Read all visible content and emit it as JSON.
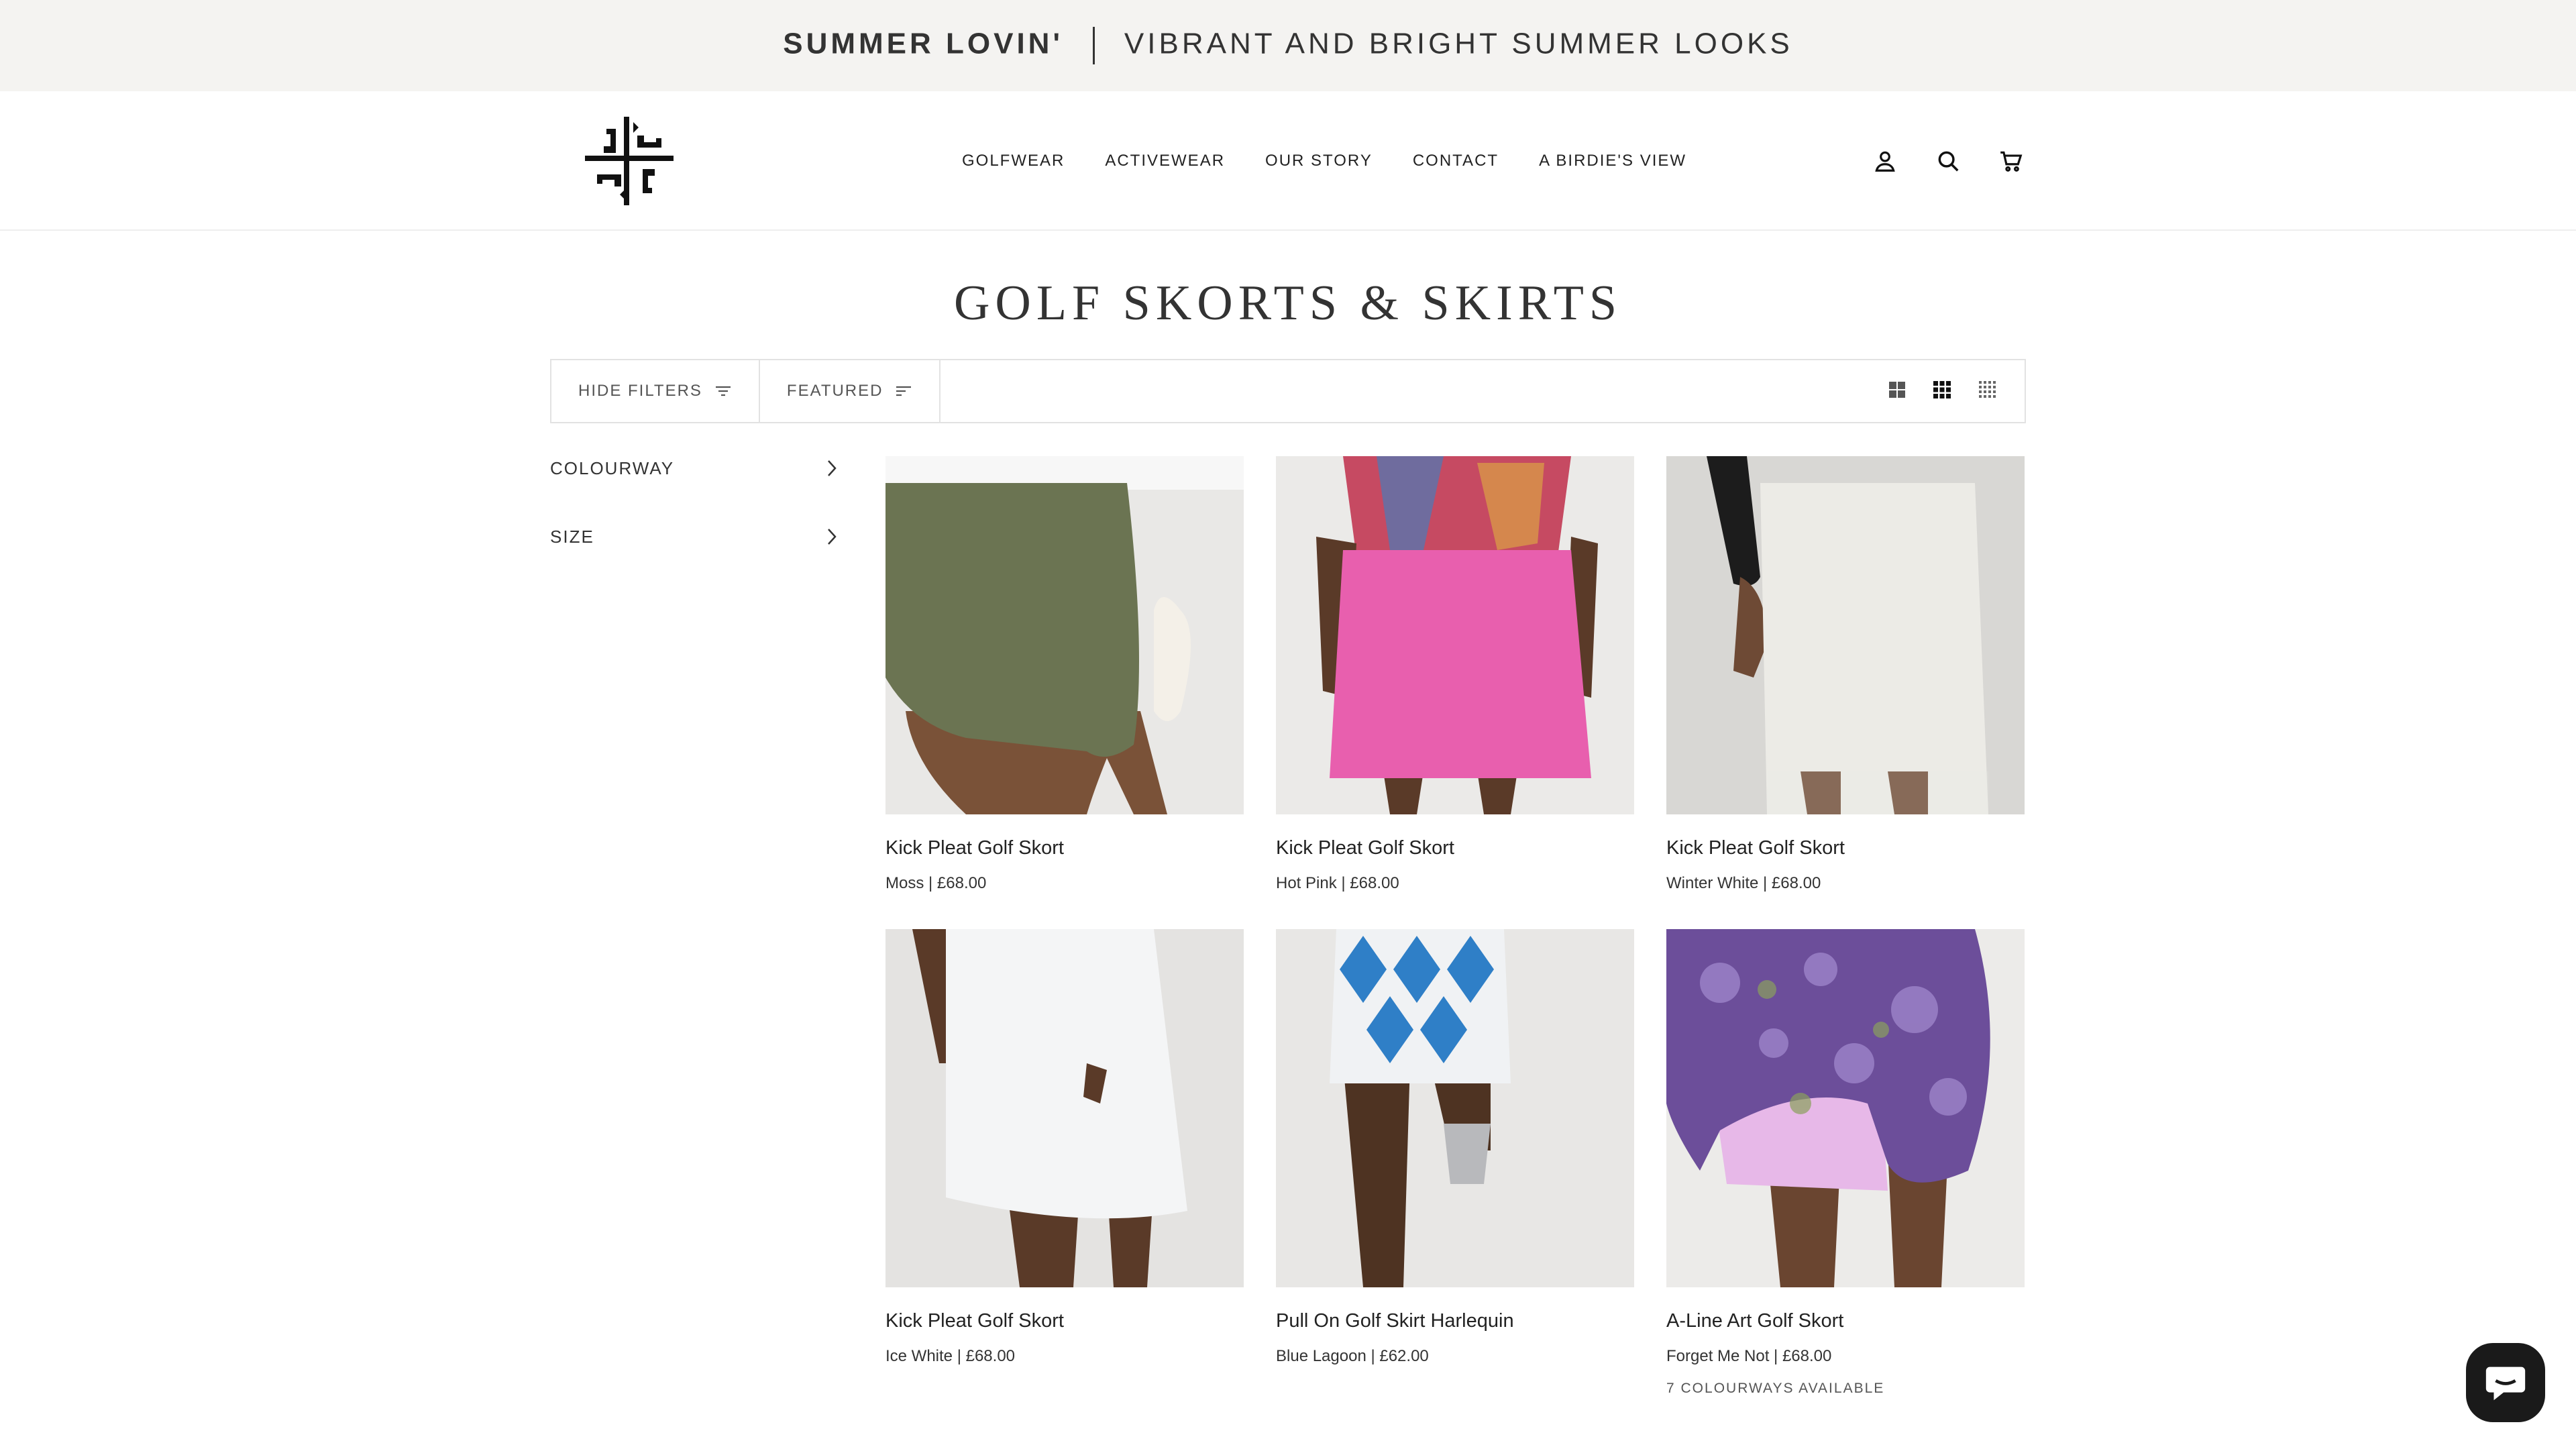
{
  "announcement": {
    "bold": "SUMMER LOVIN'",
    "text": "VIBRANT AND BRIGHT SUMMER LOOKS"
  },
  "header": {
    "logo": "brand-logo",
    "nav": [
      "GOLFWEAR",
      "ACTIVEWEAR",
      "OUR STORY",
      "CONTACT",
      "A BIRDIE'S VIEW"
    ],
    "icons": [
      "account-icon",
      "search-icon",
      "cart-icon"
    ]
  },
  "page": {
    "title": "GOLF SKORTS & SKIRTS"
  },
  "toolbar": {
    "hide_filters": "HIDE FILTERS",
    "sort": "FEATURED",
    "view_icons": [
      "grid-large-icon",
      "grid-medium-icon",
      "grid-small-icon"
    ]
  },
  "filters": [
    {
      "label": "COLOURWAY"
    },
    {
      "label": "SIZE"
    }
  ],
  "products": [
    {
      "name": "Kick Pleat Golf Skort",
      "sub": "Moss | £68.00",
      "extra": "",
      "color": "#6b7452"
    },
    {
      "name": "Kick Pleat Golf Skort",
      "sub": "Hot Pink | £68.00",
      "extra": "",
      "color": "#e85fae"
    },
    {
      "name": "Kick Pleat Golf Skort",
      "sub": "Winter White | £68.00",
      "extra": "",
      "color": "#dad8d1"
    },
    {
      "name": "Kick Pleat Golf Skort",
      "sub": "Ice White | £68.00",
      "extra": "",
      "color": "#f1f2f3"
    },
    {
      "name": "Pull On Golf Skirt Harlequin",
      "sub": "Blue Lagoon | £62.00",
      "extra": "",
      "color": "#2f7fc7"
    },
    {
      "name": "A-Line Art Golf Skort",
      "sub": "Forget Me Not | £68.00",
      "extra": "7 COLOURWAYS AVAILABLE",
      "color": "#6c4e9a"
    }
  ],
  "chat": {
    "icon": "chat-icon"
  }
}
